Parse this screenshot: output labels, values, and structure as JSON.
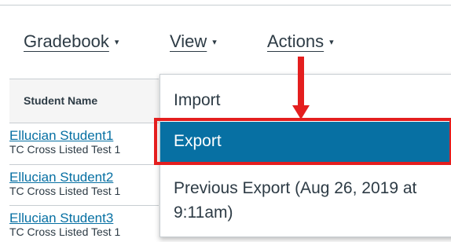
{
  "menu": {
    "gradebook_label": "Gradebook",
    "view_label": "View",
    "actions_label": "Actions",
    "caret": "▾"
  },
  "grid": {
    "column_header": "Student Name",
    "students": [
      {
        "name": "Ellucian Student1",
        "section": "TC Cross Listed Test 1"
      },
      {
        "name": "Ellucian Student2",
        "section": "TC Cross Listed Test 1"
      },
      {
        "name": "Ellucian Student3",
        "section": "TC Cross Listed Test 1"
      }
    ]
  },
  "actions_dropdown": {
    "items": [
      {
        "label": "Import"
      },
      {
        "label": "Export"
      },
      {
        "label": "Previous Export (Aug 26, 2019 at 9:11am)"
      }
    ],
    "selected_color": "#0770a3"
  },
  "annotation": {
    "color": "#e41e1e",
    "highlighted_item": "Export"
  }
}
